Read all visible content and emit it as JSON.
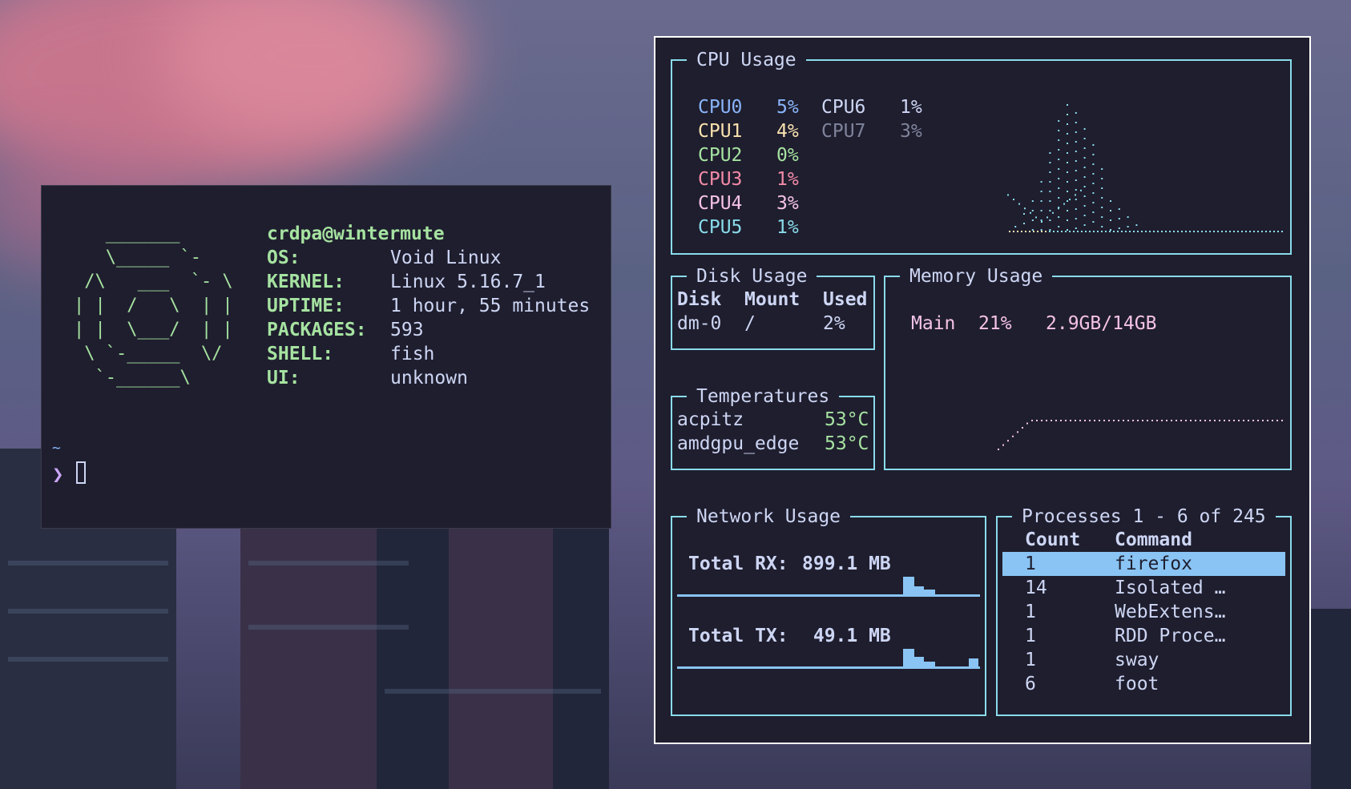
{
  "terminal": {
    "ascii_logo": "   _______\n   \\_____ `-\n /\\   ___  `- \\\n| |  /   \\  | |\n| |  \\___/  | |\n \\ `-_____  \\/\n  `-______\\",
    "user_host": "crdpa@wintermute",
    "info": [
      {
        "key": "OS:",
        "value": "Void Linux"
      },
      {
        "key": "KERNEL:",
        "value": "Linux 5.16.7_1"
      },
      {
        "key": "UPTIME:",
        "value": "1 hour, 55 minutes"
      },
      {
        "key": "PACKAGES:",
        "value": "593"
      },
      {
        "key": "SHELL:",
        "value": "fish"
      },
      {
        "key": "UI:",
        "value": "unknown"
      }
    ],
    "cwd": "~",
    "prompt_symbol": "❯"
  },
  "cpu": {
    "title": "CPU Usage",
    "cores": [
      {
        "name": "CPU0",
        "value": "5%",
        "color": "#89b4fa"
      },
      {
        "name": "CPU1",
        "value": "4%",
        "color": "#f9e2af"
      },
      {
        "name": "CPU2",
        "value": "0%",
        "color": "#a6e3a1"
      },
      {
        "name": "CPU3",
        "value": "1%",
        "color": "#f38ba8"
      },
      {
        "name": "CPU4",
        "value": "3%",
        "color": "#f5c2e7"
      },
      {
        "name": "CPU5",
        "value": "1%",
        "color": "#89dceb"
      },
      {
        "name": "CPU6",
        "value": "1%",
        "color": "#cdd6f4"
      },
      {
        "name": "CPU7",
        "value": "3%",
        "color": "#7f849c"
      }
    ]
  },
  "disk": {
    "title": "Disk Usage",
    "headers": [
      "Disk",
      "Mount",
      "Used"
    ],
    "rows": [
      [
        "dm-0",
        "/",
        "2%"
      ]
    ]
  },
  "temps": {
    "title": "Temperatures",
    "rows": [
      {
        "sensor": "acpitz",
        "value": "53°C"
      },
      {
        "sensor": "amdgpu_edge",
        "value": "53°C"
      }
    ]
  },
  "memory": {
    "title": "Memory Usage",
    "label": "Main",
    "percent": "21%",
    "amount": "2.9GB/14GB",
    "usage_fraction": 0.21
  },
  "network": {
    "title": "Network Usage",
    "rx_label": "Total RX:",
    "rx_value": "899.1 MB",
    "tx_label": "Total TX:",
    "tx_value": " 49.1 MB"
  },
  "processes": {
    "title": "Processes 1 - 6 of 245",
    "headers": [
      "Count",
      "Command"
    ],
    "rows": [
      {
        "count": "1",
        "command": "firefox"
      },
      {
        "count": "14",
        "command": "Isolated …"
      },
      {
        "count": "1",
        "command": "WebExtens…"
      },
      {
        "count": "1",
        "command": "RDD Proce…"
      },
      {
        "count": "1",
        "command": "sway"
      },
      {
        "count": "6",
        "command": "foot"
      }
    ],
    "selected_index": 0
  },
  "colors": {
    "border": "#89dceb",
    "accent_green": "#a6e3a1",
    "memory_pink": "#f5c2e7",
    "selection": "#89c4f4",
    "background": "#1f1e2e"
  }
}
